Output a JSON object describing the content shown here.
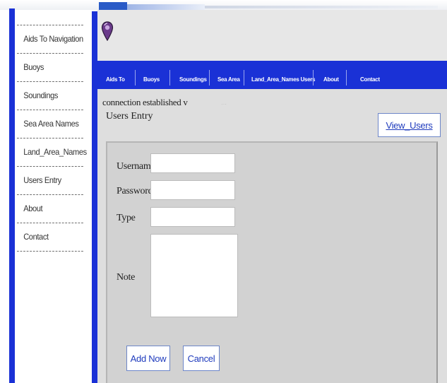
{
  "sidebar": {
    "items": [
      {
        "label": "Aids To Navigation"
      },
      {
        "label": "Buoys"
      },
      {
        "label": "Soundings"
      },
      {
        "label": "Sea Area Names"
      },
      {
        "label": "Land_Area_Names"
      },
      {
        "label": "Users Entry"
      },
      {
        "label": "About"
      },
      {
        "label": "Contact"
      }
    ]
  },
  "nav": {
    "items": [
      {
        "label": "Aids To"
      },
      {
        "label": "Buoys"
      },
      {
        "label": "Soundings"
      },
      {
        "label": "Sea Area"
      },
      {
        "label": "Land_Area_Names Users"
      },
      {
        "label": "About"
      },
      {
        "label": "Contact"
      }
    ]
  },
  "status": {
    "message": "connection established v"
  },
  "page": {
    "title": "Users Entry"
  },
  "actions": {
    "view_users": "View_Users"
  },
  "form": {
    "username_label": "Username",
    "password_label": "Password",
    "type_label": "Type",
    "note_label": "Note",
    "username_value": "",
    "password_value": "",
    "type_value": "",
    "note_value": "",
    "add_now": "Add Now",
    "cancel": "Cancel"
  },
  "icons": {
    "logo": "map-pin-icon"
  },
  "colors": {
    "nav_blue": "#1a31d6",
    "link_blue": "#1f3bbd",
    "panel_gray": "#d2d2d2"
  }
}
